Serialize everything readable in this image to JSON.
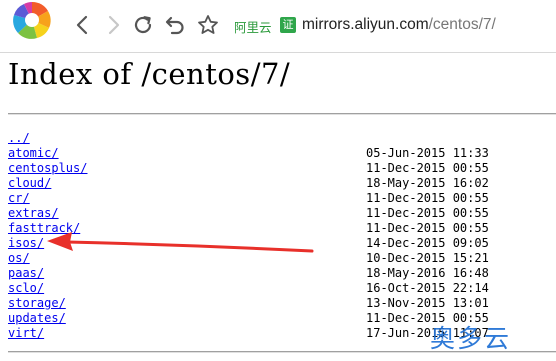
{
  "browser": {
    "site_badge": "阿里云",
    "cert_badge": "证",
    "url_host": "mirrors.aliyun.com",
    "url_path": "/centos/7/"
  },
  "page": {
    "title": "Index of /centos/7/",
    "entries": [
      {
        "name": "../",
        "date": ""
      },
      {
        "name": "atomic/",
        "date": "05-Jun-2015 11:33"
      },
      {
        "name": "centosplus/",
        "date": "11-Dec-2015 00:55"
      },
      {
        "name": "cloud/",
        "date": "18-May-2015 16:02"
      },
      {
        "name": "cr/",
        "date": "11-Dec-2015 00:55"
      },
      {
        "name": "extras/",
        "date": "11-Dec-2015 00:55"
      },
      {
        "name": "fasttrack/",
        "date": "11-Dec-2015 00:55"
      },
      {
        "name": "isos/",
        "date": "14-Dec-2015 09:05"
      },
      {
        "name": "os/",
        "date": "10-Dec-2015 15:21"
      },
      {
        "name": "paas/",
        "date": "18-May-2016 16:48"
      },
      {
        "name": "sclo/",
        "date": "16-Oct-2015 22:14"
      },
      {
        "name": "storage/",
        "date": "13-Nov-2015 13:01"
      },
      {
        "name": "updates/",
        "date": "11-Dec-2015 00:55"
      },
      {
        "name": "virt/",
        "date": "17-Jun-2015 11:07"
      }
    ]
  },
  "annotation": {
    "arrow_color": "#e8302a"
  },
  "watermark": {
    "text": "奥多云",
    "color": "#1e6fd4"
  }
}
